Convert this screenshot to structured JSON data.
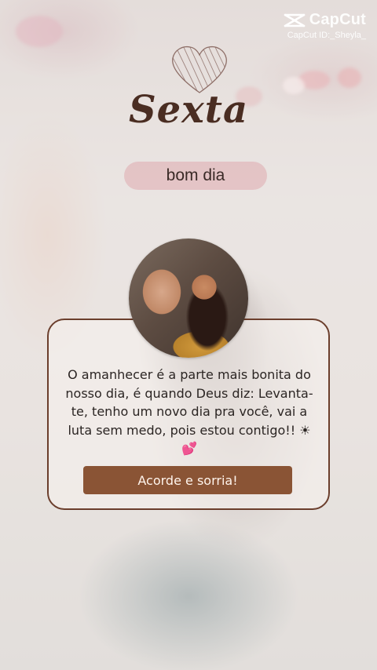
{
  "watermark": {
    "brand": "CapCut",
    "user_id": "CapCut ID:_Sheyla_"
  },
  "header": {
    "day": "Sexta",
    "greeting": "bom dia"
  },
  "card": {
    "message": "O amanhecer é a parte mais bonita do nosso dia, é quando Deus diz: Levanta-te, tenho um novo dia pra você, vai a luta sem medo, pois estou contigo!! ☀ 💕",
    "button_label": "Acorde e sorria!"
  },
  "icons": [
    "capcut-logo-icon",
    "heart-icon"
  ],
  "colors": {
    "title": "#4a2d22",
    "card_border": "#6b3e2c",
    "button": "#8a5435",
    "pill": "#deaaaf"
  }
}
